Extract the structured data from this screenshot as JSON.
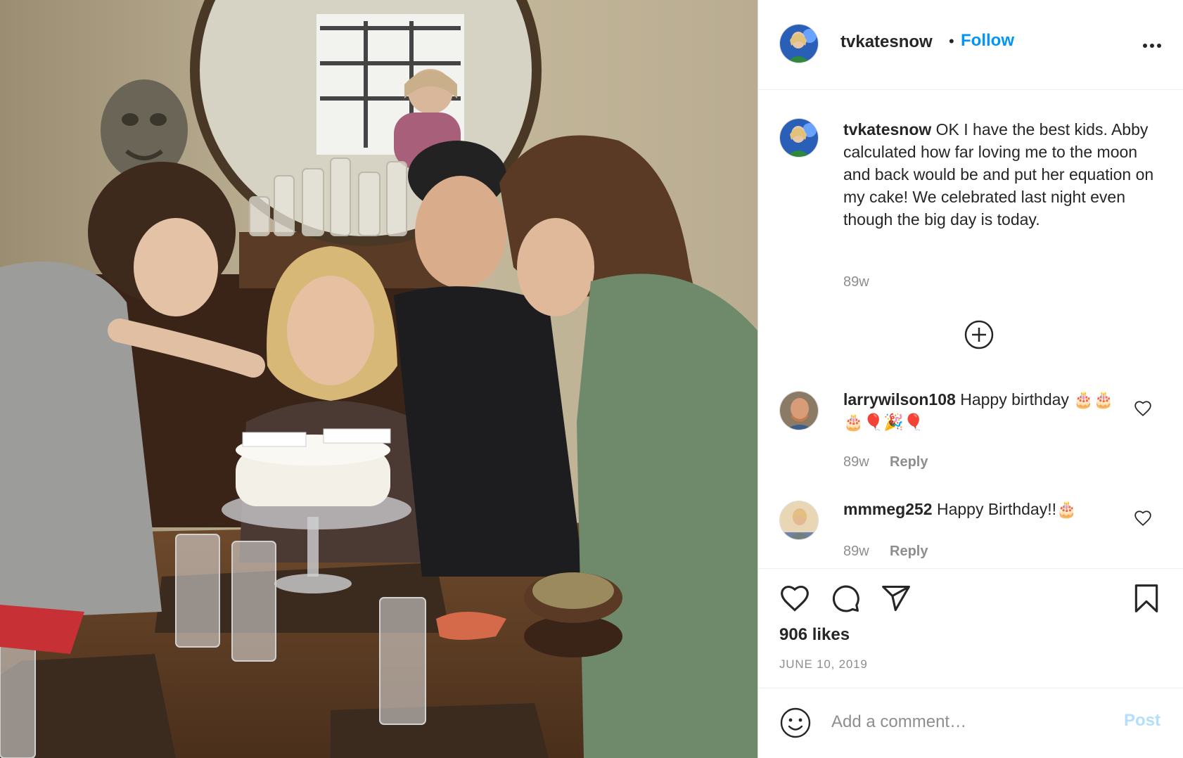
{
  "post": {
    "username": "tvkatesnow",
    "follow_label": "Follow",
    "dot": "•",
    "more_icon": "more-horizontal-icon"
  },
  "caption": {
    "username": "tvkatesnow",
    "text": "OK I have the best kids. Abby calculated how far loving me to the moon and back would be and put her equation on my cake! We celebrated last night even though the big day is today.",
    "time": "89w"
  },
  "load_more_icon": "plus-circle-icon",
  "comments": [
    {
      "username": "larrywilson108",
      "text": "Happy birthday 🎂🎂🎂🎈🎉🎈",
      "time": "89w",
      "reply_label": "Reply"
    },
    {
      "username": "mmmeg252",
      "text": "Happy Birthday!!🎂",
      "time": "89w",
      "reply_label": "Reply"
    }
  ],
  "actions": {
    "like_icon": "heart-icon",
    "comment_icon": "comment-icon",
    "share_icon": "paper-plane-icon",
    "save_icon": "bookmark-icon",
    "likes_text": "906 likes",
    "date": "JUNE 10, 2019"
  },
  "add_comment": {
    "emoji_icon": "smiley-icon",
    "placeholder": "Add a comment…",
    "post_label": "Post"
  },
  "colors": {
    "link_blue": "#0095f6",
    "post_disabled": "#b2dffc",
    "secondary_text": "#8e8e8e",
    "primary_text": "#262626",
    "border": "#dbdbdb"
  }
}
